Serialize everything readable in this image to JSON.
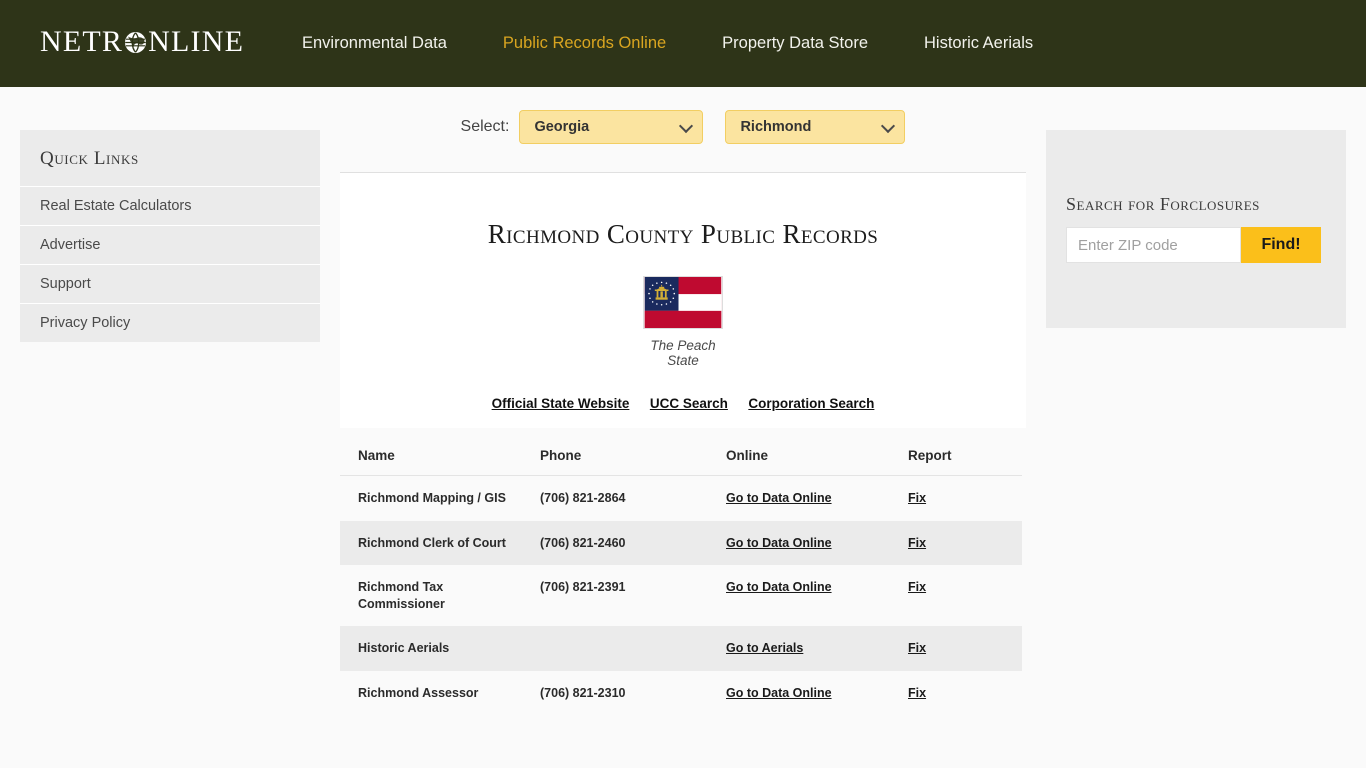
{
  "header": {
    "logo_text_a": "NETR",
    "logo_icon": "globe-icon",
    "logo_text_b": "NLINE",
    "nav": [
      {
        "label": "Environmental Data",
        "active": false
      },
      {
        "label": "Public Records Online",
        "active": true
      },
      {
        "label": "Property Data Store",
        "active": false
      },
      {
        "label": "Historic Aerials",
        "active": false
      }
    ]
  },
  "select_bar": {
    "label": "Select:",
    "state": {
      "value": "Georgia"
    },
    "county": {
      "value": "Richmond"
    }
  },
  "sidebar_left": {
    "title": "Quick Links",
    "items": [
      {
        "label": "Real Estate Calculators"
      },
      {
        "label": "Advertise"
      },
      {
        "label": "Support"
      },
      {
        "label": "Privacy Policy"
      }
    ]
  },
  "sidebar_right": {
    "title": "Search for Forclosures",
    "zip_placeholder": "Enter ZIP code",
    "zip_value": "",
    "find_label": "Find!"
  },
  "main": {
    "title": "Richmond County Public Records",
    "flag_alt": "georgia-state-flag",
    "flag_caption": "The Peach State",
    "state_links": [
      {
        "label": "Official State Website"
      },
      {
        "label": "UCC Search"
      },
      {
        "label": "Corporation Search"
      }
    ]
  },
  "table": {
    "columns": [
      "Name",
      "Phone",
      "Online",
      "Report"
    ],
    "rows": [
      {
        "name": "Richmond Mapping / GIS",
        "phone": "(706) 821-2864",
        "online": "Go to Data Online",
        "report": "Fix"
      },
      {
        "name": "Richmond Clerk of Court",
        "phone": "(706) 821-2460",
        "online": "Go to Data Online",
        "report": "Fix"
      },
      {
        "name": "Richmond Tax Commissioner",
        "phone": "(706) 821-2391",
        "online": "Go to Data Online",
        "report": "Fix"
      },
      {
        "name": "Historic Aerials",
        "phone": "",
        "online": "Go to Aerials",
        "report": "Fix"
      },
      {
        "name": "Richmond Assessor",
        "phone": "(706) 821-2310",
        "online": "Go to Data Online",
        "report": "Fix"
      }
    ]
  },
  "colors": {
    "header_bg": "#2E3418",
    "nav_active": "#D9A520",
    "select_bg": "#FBE4A0",
    "find_button": "#FBBF1A",
    "panel_bg": "#EBEBEB",
    "page_bg": "#FAFAFA"
  }
}
